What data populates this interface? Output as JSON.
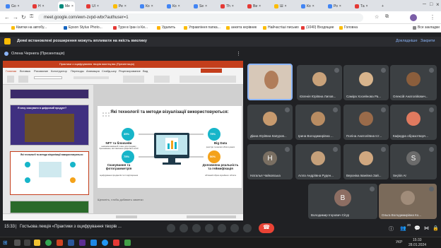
{
  "browser": {
    "tabs": [
      {
        "label": "Go",
        "color": "#4285f4"
      },
      {
        "label": "Н",
        "color": "#e53935"
      },
      {
        "label": "Me",
        "color": "#00897b"
      },
      {
        "label": "UI",
        "color": "#e53935"
      },
      {
        "label": "Ре",
        "color": "#fbbc04"
      },
      {
        "label": "Ко",
        "color": "#4285f4"
      },
      {
        "label": "Ко",
        "color": "#4285f4"
      },
      {
        "label": "Se",
        "color": "#4285f4"
      },
      {
        "label": "Тh",
        "color": "#e53935"
      },
      {
        "label": "Ви",
        "color": "#e53935"
      },
      {
        "label": "Ш",
        "color": "#fbbc04"
      },
      {
        "label": "Ко",
        "color": "#4285f4"
      },
      {
        "label": "Ро",
        "color": "#4285f4"
      },
      {
        "label": "Та",
        "color": "#e53935"
      }
    ],
    "url": "meet.google.com/ewn-zvpd-wbx?authuser=1",
    "bookmarks": [
      "Квитки на автобу...",
      "Epson Stylus Photo...",
      "Тури в Іран із Ки...",
      "Удалить",
      "Управління папка...",
      "анкета керівник",
      "Найчастіші письмо",
      "(1040) Входящие",
      "Головна",
      "Все закладки"
    ]
  },
  "meet": {
    "banner": "Деякі встановлені розширення можуть впливати на якість виклику",
    "banner_details": "Докладніше",
    "banner_close": "Закрити",
    "presenter": "Олена Чернега (Презентація)",
    "slide_title": "Які технології та методи візуалізації використовуються:",
    "slide_items": [
      {
        "title": "NFT та блокчейн",
        "desc": "невзаємозамінний токен для продажу бронювання, виставляння цифрових копій",
        "pct": "35%"
      },
      {
        "title": "Big Data",
        "desc": "реєстри та великі обсяги даних",
        "pct": "75%"
      },
      {
        "title": "Сканування та фотограмметрія",
        "desc": "оцифрування предметів та їх відтворення",
        "pct": "75%"
      },
      {
        "title": "Доповнена реальність та геймифікація",
        "desc": "об'ємний образ музейного об'єкта",
        "pct": "50%"
      }
    ],
    "notes_placeholder": "Щелкніть, чтобы добавить заметки",
    "thumb_title": "Які технології та методи візуалізації використовуються:",
    "thumb2_title": "Я хочу скасувати в цифровий продукт?",
    "participants": [
      {
        "name": "Євгенія Юріївна Липов...",
        "color": "#c9a27a"
      },
      {
        "name": "Саміра Хосейнова Ра...",
        "color": "#d8b48c"
      },
      {
        "name": "Олексій Анатолійович...",
        "color": "#8b5e3c"
      },
      {
        "name": "Діана Юріївна Капуров...",
        "color": "#c79a6e"
      },
      {
        "name": "Ірина Володимирівна ...",
        "color": "#b88c62"
      },
      {
        "name": "Поліна Анатоліївна Іст...",
        "color": "#9a6b4a"
      },
      {
        "name": "Кафедра образотворч...",
        "color": "#e07a5f"
      },
      {
        "name": "Наталья Чайковська",
        "letter": "Н",
        "color": "#7a6f62"
      },
      {
        "name": "Алла Андріївна Руден...",
        "color": "#c5a07a"
      },
      {
        "name": "Вероніка Іванівна Зай...",
        "color": "#d1a880"
      },
      {
        "name": "Seçkin Ar",
        "letter": "S",
        "color": "#6b6b6b"
      },
      {
        "name": "Володимир Ігорович Сігур",
        "letter": "В",
        "color": "#8d6e63"
      },
      {
        "name": "Ольга Володимирівна Ко...",
        "color": "#a08c7a"
      }
    ],
    "time": "15:33",
    "meeting_title": "Гостьова лекція «Практики з оцифрування творів ...",
    "participant_count": "20"
  },
  "taskbar": {
    "time": "15:33",
    "date": "28.01.2024",
    "lang": "УКР"
  },
  "colors": {
    "accent_red": "#ea4335",
    "meet_bg": "#202124",
    "tile_bg": "#3c4043",
    "teal": "#17b5c9",
    "orange": "#f4a21a"
  }
}
